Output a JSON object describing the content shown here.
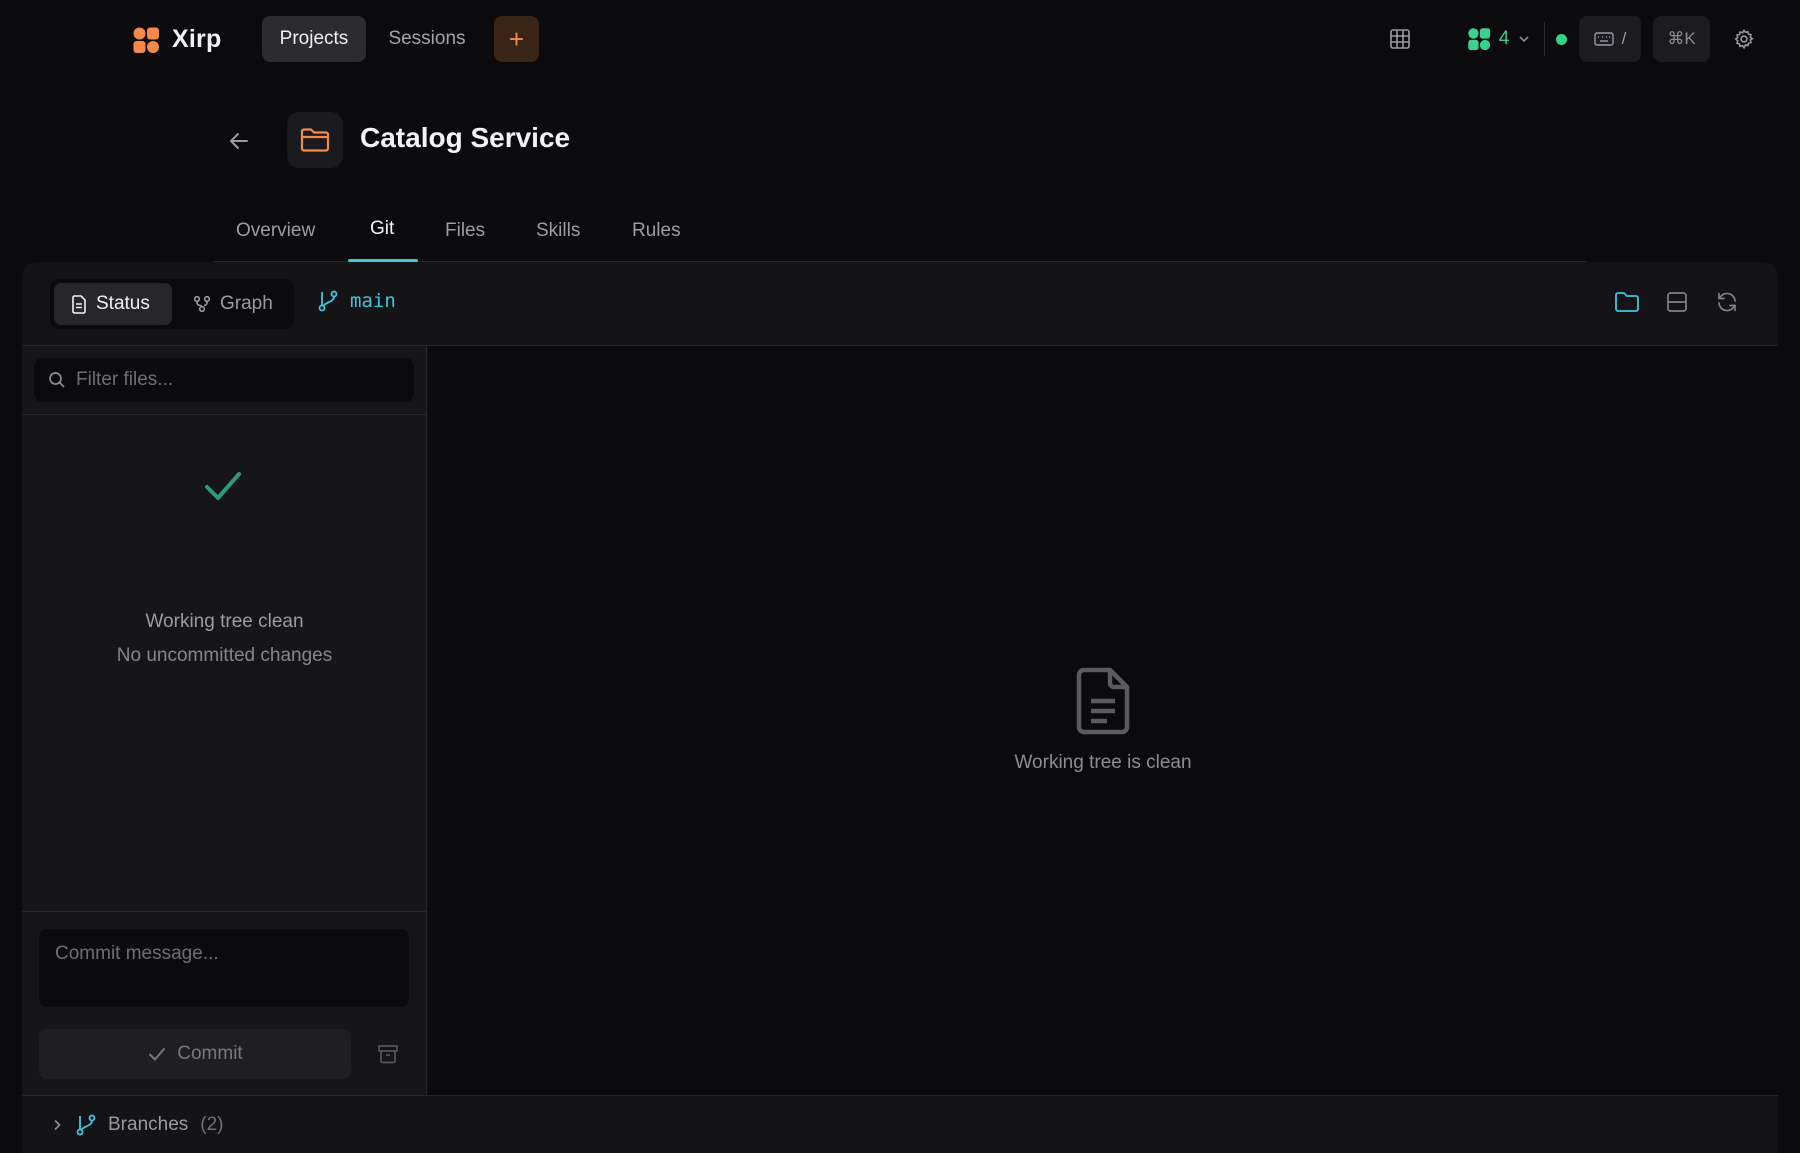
{
  "app": {
    "name": "Xirp"
  },
  "nav": {
    "projects": "Projects",
    "sessions": "Sessions",
    "add": "+"
  },
  "toolbar": {
    "workers_count": "4",
    "kbd_shortcut": "/",
    "cmdk": "⌘K"
  },
  "project": {
    "title": "Catalog Service"
  },
  "tabs": [
    "Overview",
    "Git",
    "Files",
    "Skills",
    "Rules"
  ],
  "active_tab": "Git",
  "git": {
    "view_status": "Status",
    "view_graph": "Graph",
    "branch": "main",
    "filter_placeholder": "Filter files...",
    "clean_title": "Working tree clean",
    "clean_sub": "No uncommitted changes",
    "commit_placeholder": "Commit message...",
    "commit_label": "Commit",
    "right_message": "Working tree is clean",
    "branches_label": "Branches",
    "branches_count": "(2)"
  },
  "colors": {
    "accent_cyan": "#3ec6e0",
    "accent_orange": "#f5894a",
    "status_green": "#2fd38a",
    "check_green": "#2f9a78"
  },
  "icons": [
    "logo-icon",
    "grid-icon",
    "workers-icon",
    "chevron-down-icon",
    "keyboard-icon",
    "gear-icon",
    "arrow-left-icon",
    "folder-icon",
    "document-icon",
    "graph-icon",
    "git-branch-icon",
    "layout-icon",
    "refresh-icon",
    "search-icon",
    "check-icon",
    "archive-icon",
    "chevron-right-icon"
  ]
}
